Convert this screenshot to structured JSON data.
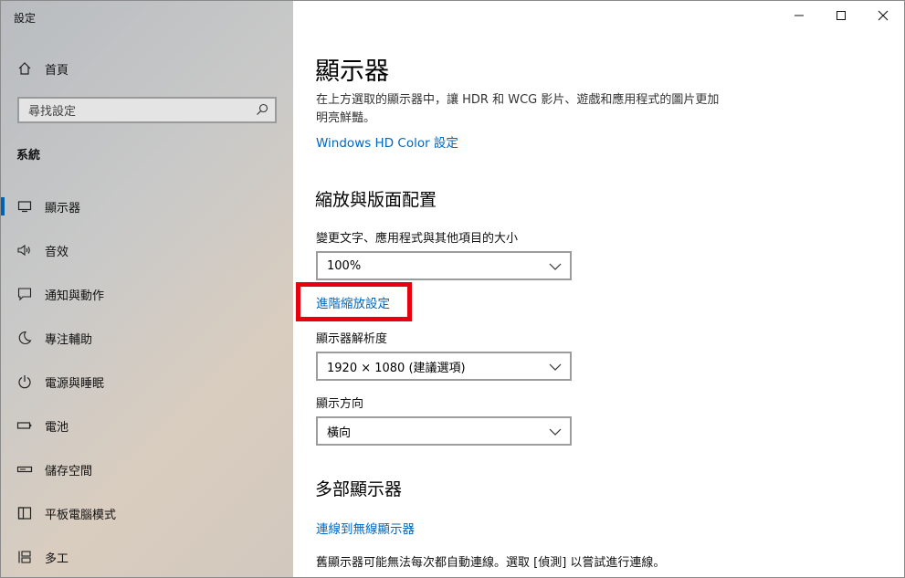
{
  "window": {
    "title": "設定"
  },
  "sidebar": {
    "home_label": "首頁",
    "search_placeholder": "尋找設定",
    "section_title": "系統",
    "items": [
      {
        "label": "顯示器",
        "icon": "monitor-icon",
        "selected": true
      },
      {
        "label": "音效",
        "icon": "speaker-icon",
        "selected": false
      },
      {
        "label": "通知與動作",
        "icon": "message-icon",
        "selected": false
      },
      {
        "label": "專注輔助",
        "icon": "moon-icon",
        "selected": false
      },
      {
        "label": "電源與睡眠",
        "icon": "power-icon",
        "selected": false
      },
      {
        "label": "電池",
        "icon": "battery-icon",
        "selected": false
      },
      {
        "label": "儲存空間",
        "icon": "storage-icon",
        "selected": false
      },
      {
        "label": "平板電腦模式",
        "icon": "tablet-icon",
        "selected": false
      },
      {
        "label": "多工",
        "icon": "multitask-icon",
        "selected": false
      }
    ]
  },
  "main": {
    "title": "顯示器",
    "hdr_description": "在上方選取的顯示器中，讓 HDR 和 WCG 影片、遊戲和應用程式的圖片更加明亮鮮豔。",
    "hdr_link": "Windows HD Color 設定",
    "scale_section": "縮放與版面配置",
    "scale_label": "變更文字、應用程式與其他項目的大小",
    "scale_value": "100%",
    "advanced_scaling_link": "進階縮放設定",
    "resolution_label": "顯示器解析度",
    "resolution_value": "1920 × 1080 (建議選項)",
    "orientation_label": "顯示方向",
    "orientation_value": "橫向",
    "multi_section": "多部顯示器",
    "wireless_link": "連線到無線顯示器",
    "multi_note": "舊顯示器可能無法每次都自動連線。選取 [偵測] 以嘗試進行連線。"
  },
  "colors": {
    "accent": "#0063b1",
    "link": "#0067c0",
    "highlight": "#e8000f"
  }
}
